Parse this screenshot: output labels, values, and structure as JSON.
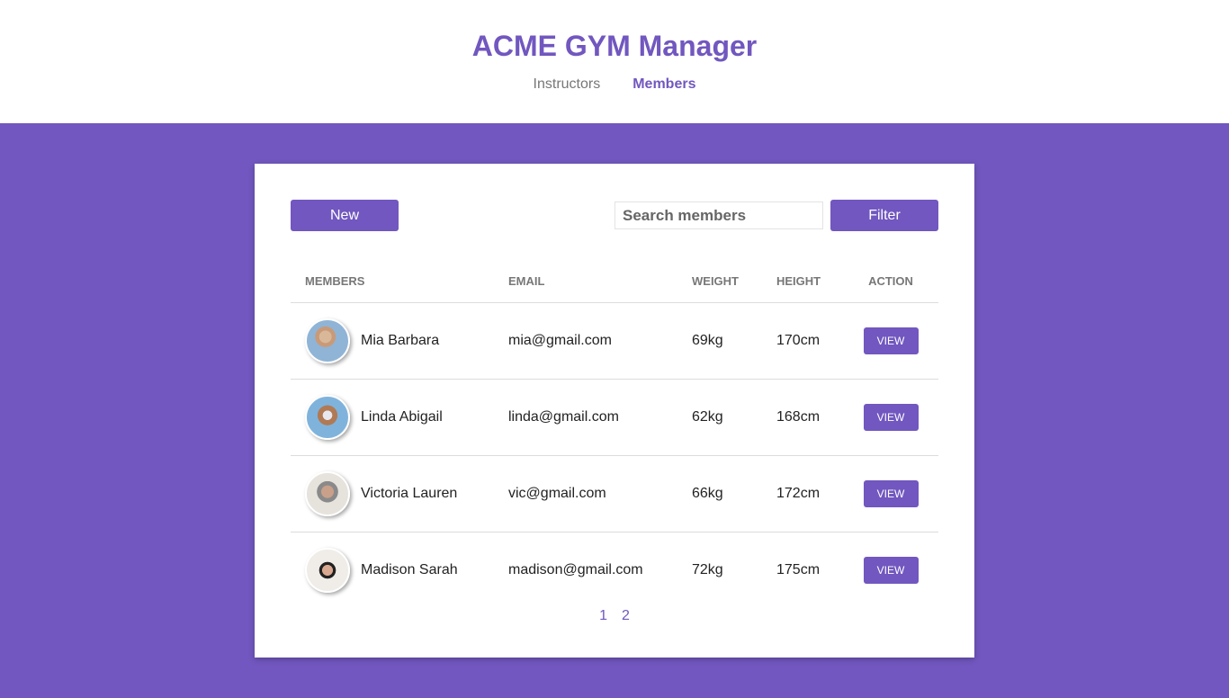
{
  "header": {
    "title": "ACME GYM Manager",
    "nav": [
      {
        "label": "Instructors",
        "active": false
      },
      {
        "label": "Members",
        "active": true
      }
    ]
  },
  "toolbar": {
    "new_label": "New",
    "search_placeholder": "Search members",
    "filter_label": "Filter"
  },
  "table": {
    "columns": [
      "MEMBERS",
      "EMAIL",
      "WEIGHT",
      "HEIGHT",
      "ACTION"
    ],
    "rows": [
      {
        "name": "Mia Barbara",
        "email": "mia@gmail.com",
        "weight": "69kg",
        "height": "170cm",
        "action": "VIEW"
      },
      {
        "name": "Linda Abigail",
        "email": "linda@gmail.com",
        "weight": "62kg",
        "height": "168cm",
        "action": "VIEW"
      },
      {
        "name": "Victoria Lauren",
        "email": "vic@gmail.com",
        "weight": "66kg",
        "height": "172cm",
        "action": "VIEW"
      },
      {
        "name": "Madison Sarah",
        "email": "madison@gmail.com",
        "weight": "72kg",
        "height": "175cm",
        "action": "VIEW"
      }
    ]
  },
  "pagination": [
    "1",
    "2"
  ],
  "colors": {
    "brand": "#7157bf",
    "background": "#7157bf",
    "card": "#ffffff"
  }
}
